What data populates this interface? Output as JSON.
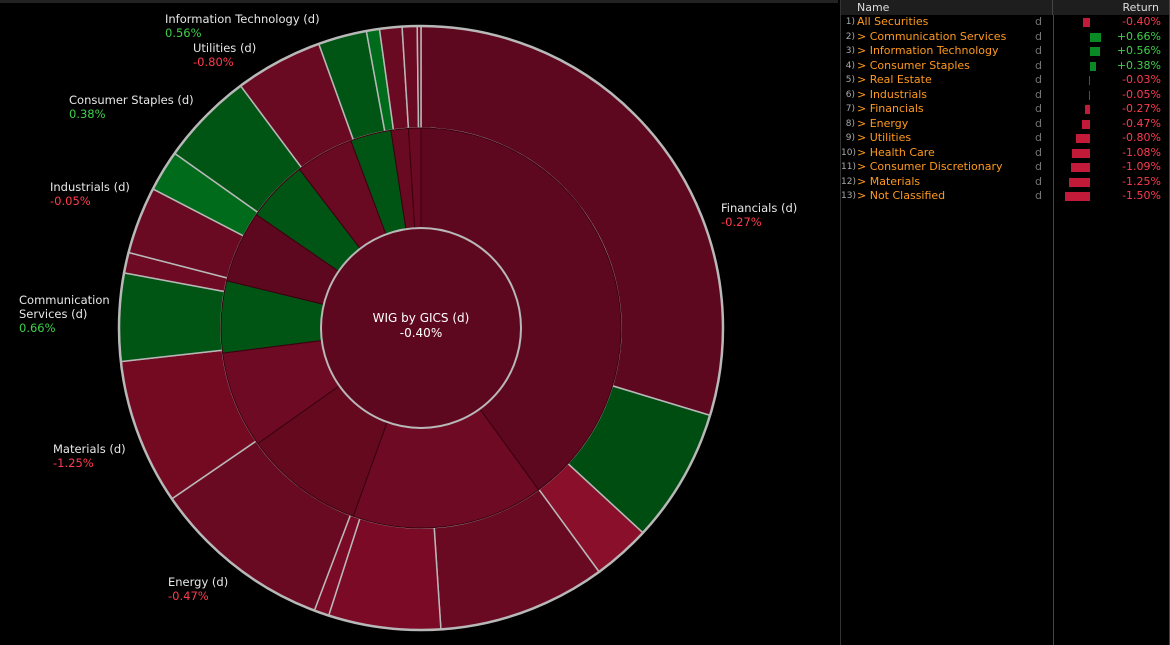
{
  "chart_data": {
    "type": "sunburst",
    "title": "WIG by GICS (d)",
    "center_value": "-0.40%",
    "center_return": -0.4,
    "colors": {
      "positive": "#005514",
      "positive_bright": "#006b1a",
      "negative_dark": "#5e0820",
      "negative": "#6e0a24",
      "negative_bright": "#8a0f2a",
      "border": "#b8b8b8"
    },
    "sectors": [
      {
        "name": "Financials (d)",
        "value": "-0.27%",
        "ret": -0.27,
        "weight": 40.0,
        "color": "#5e0820"
      },
      {
        "name": "",
        "value": "",
        "ret": -1.08,
        "weight": 15.5,
        "color": "#6e0a24"
      },
      {
        "name": "Energy (d)",
        "value": "-0.47%",
        "ret": -0.47,
        "weight": 9.7,
        "color": "#65091f"
      },
      {
        "name": "Materials (d)",
        "value": "-1.25%",
        "ret": -1.25,
        "weight": 7.8,
        "color": "#6e0a24"
      },
      {
        "name": "Communication Services (d)",
        "value": "0.66%",
        "ret": 0.66,
        "weight": 5.8,
        "color": "#005514"
      },
      {
        "name": "Industrials (d)",
        "value": "-0.05%",
        "ret": -0.05,
        "weight": 5.8,
        "color": "#5e0820"
      },
      {
        "name": "Consumer Staples (d)",
        "value": "0.38%",
        "ret": 0.38,
        "weight": 5.0,
        "color": "#005514"
      },
      {
        "name": "Utilities (d)",
        "value": "-0.80%",
        "ret": -0.8,
        "weight": 4.7,
        "color": "#6a0a22"
      },
      {
        "name": "Information Technology (d)",
        "value": "0.56%",
        "ret": 0.56,
        "weight": 3.3,
        "color": "#005514"
      },
      {
        "name": "",
        "value": "",
        "ret": -1.09,
        "weight": 1.4,
        "color": "#6a0a22"
      },
      {
        "name": "",
        "value": "",
        "ret": -1.5,
        "weight": 1.0,
        "color": "#6a0a22"
      }
    ],
    "constituents": [
      {
        "weight": 29.7,
        "color": "#5e0820"
      },
      {
        "weight": 7.2,
        "color": "#004d12"
      },
      {
        "weight": 3.1,
        "color": "#8a0f2a"
      },
      {
        "weight": 9.0,
        "color": "#6a0a22"
      },
      {
        "weight": 6.0,
        "color": "#7a0a25"
      },
      {
        "weight": 0.8,
        "color": "#7a0a25"
      },
      {
        "weight": 9.7,
        "color": "#6a0a22"
      },
      {
        "weight": 7.8,
        "color": "#730a22"
      },
      {
        "weight": 4.7,
        "color": "#005514"
      },
      {
        "weight": 1.1,
        "color": "#6e0a24"
      },
      {
        "weight": 3.6,
        "color": "#6a0a22"
      },
      {
        "weight": 2.2,
        "color": "#006b1a"
      },
      {
        "weight": 5.0,
        "color": "#005514"
      },
      {
        "weight": 4.7,
        "color": "#6a0a22"
      },
      {
        "weight": 2.6,
        "color": "#005514"
      },
      {
        "weight": 0.7,
        "color": "#006b1a"
      },
      {
        "weight": 1.2,
        "color": "#6a0a22"
      },
      {
        "weight": 0.8,
        "color": "#6a0a22"
      },
      {
        "weight": 0.2,
        "color": "#6a0a22"
      }
    ]
  },
  "table": {
    "headers": {
      "name": "Name",
      "return": "Return"
    },
    "rows": [
      {
        "idx": "1)",
        "name": "All Securities",
        "flag": "d",
        "ret": "-0.40%",
        "value": -0.4
      },
      {
        "idx": "2)",
        "name": "> Communication Services",
        "flag": "d",
        "ret": "+0.66%",
        "value": 0.66
      },
      {
        "idx": "3)",
        "name": "> Information Technology",
        "flag": "d",
        "ret": "+0.56%",
        "value": 0.56
      },
      {
        "idx": "4)",
        "name": "> Consumer Staples",
        "flag": "d",
        "ret": "+0.38%",
        "value": 0.38
      },
      {
        "idx": "5)",
        "name": "> Real Estate",
        "flag": "d",
        "ret": "-0.03%",
        "value": -0.03
      },
      {
        "idx": "6)",
        "name": "> Industrials",
        "flag": "d",
        "ret": "-0.05%",
        "value": -0.05
      },
      {
        "idx": "7)",
        "name": "> Financials",
        "flag": "d",
        "ret": "-0.27%",
        "value": -0.27
      },
      {
        "idx": "8)",
        "name": "> Energy",
        "flag": "d",
        "ret": "-0.47%",
        "value": -0.47
      },
      {
        "idx": "9)",
        "name": "> Utilities",
        "flag": "d",
        "ret": "-0.80%",
        "value": -0.8
      },
      {
        "idx": "10)",
        "name": "> Health Care",
        "flag": "d",
        "ret": "-1.08%",
        "value": -1.08
      },
      {
        "idx": "11)",
        "name": "> Consumer Discretionary",
        "flag": "d",
        "ret": "-1.09%",
        "value": -1.09
      },
      {
        "idx": "12)",
        "name": "> Materials",
        "flag": "d",
        "ret": "-1.25%",
        "value": -1.25
      },
      {
        "idx": "13)",
        "name": "> Not Classified",
        "flag": "d",
        "ret": "-1.50%",
        "value": -1.5
      }
    ]
  }
}
